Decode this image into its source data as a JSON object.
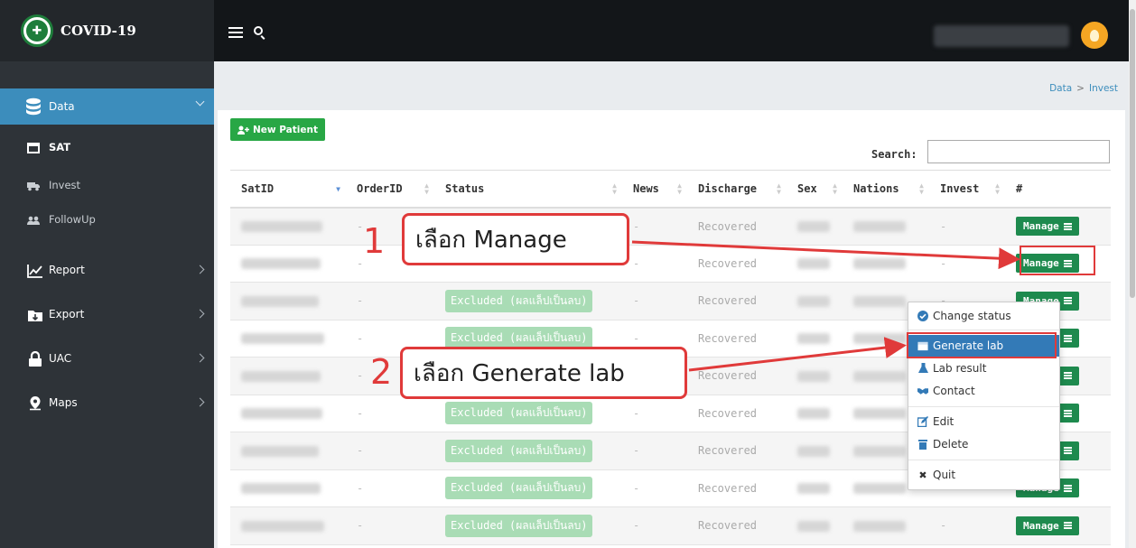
{
  "app": {
    "title": "COVID-19"
  },
  "sidebar": {
    "items": [
      {
        "label": "Data",
        "icon": "database-icon"
      },
      {
        "label": "SAT",
        "icon": "window-icon"
      },
      {
        "label": "Invest",
        "icon": "truck-icon"
      },
      {
        "label": "FollowUp",
        "icon": "users-icon"
      },
      {
        "label": "Report",
        "icon": "line-chart-icon"
      },
      {
        "label": "Export",
        "icon": "folder-icon"
      },
      {
        "label": "UAC",
        "icon": "lock-icon"
      },
      {
        "label": "Maps",
        "icon": "map-marker-icon"
      }
    ]
  },
  "breadcrumb": {
    "home": "Data",
    "sep": ">",
    "current": "Invest"
  },
  "toolbar": {
    "new_patient": "New Patient",
    "search_label": "Search:",
    "search_value": ""
  },
  "table": {
    "columns": [
      "SatID",
      "OrderID",
      "Status",
      "News",
      "Discharge",
      "Sex",
      "Nations",
      "Invest",
      "#"
    ],
    "rows": [
      {
        "order": "-",
        "status": "",
        "news": "-",
        "discharge": "Recovered",
        "invest": "-",
        "action": "Manage"
      },
      {
        "order": "-",
        "status": "",
        "news": "-",
        "discharge": "Recovered",
        "invest": "-",
        "action": "Manage"
      },
      {
        "order": "-",
        "status": "Excluded (ผลแล็ปเป็นลบ)",
        "news": "-",
        "discharge": "Recovered",
        "invest": "-",
        "action": "Manage"
      },
      {
        "order": "-",
        "status": "Excluded (ผลแล็ปเป็นลบ)",
        "news": "-",
        "discharge": "Recovered",
        "invest": "-",
        "action": "Manage"
      },
      {
        "order": "-",
        "status": "",
        "news": "-",
        "discharge": "Recovered",
        "invest": "",
        "action": "Manage"
      },
      {
        "order": "-",
        "status": "Excluded (ผลแล็ปเป็นลบ)",
        "news": "-",
        "discharge": "Recovered",
        "invest": "",
        "action": "Manage"
      },
      {
        "order": "-",
        "status": "Excluded (ผลแล็ปเป็นลบ)",
        "news": "-",
        "discharge": "Recovered",
        "invest": "",
        "action": "Manage"
      },
      {
        "order": "-",
        "status": "Excluded (ผลแล็ปเป็นลบ)",
        "news": "-",
        "discharge": "Recovered",
        "invest": "",
        "action": "Manage"
      },
      {
        "order": "-",
        "status": "Excluded (ผลแล็ปเป็นลบ)",
        "news": "-",
        "discharge": "Recovered",
        "invest": "-",
        "action": "Manage"
      }
    ]
  },
  "dropdown": {
    "items": [
      {
        "label": "Change status",
        "icon": "check-circle-icon"
      },
      {
        "label": "Generate lab",
        "icon": "window-icon"
      },
      {
        "label": "Lab result",
        "icon": "flask-icon"
      },
      {
        "label": "Contact",
        "icon": "handshake-icon"
      },
      {
        "label": "Edit",
        "icon": "edit-icon"
      },
      {
        "label": "Delete",
        "icon": "trash-icon"
      },
      {
        "label": "Quit",
        "icon": "close-icon"
      }
    ]
  },
  "annotations": {
    "step1_num": "1",
    "step1_text": "เลือก Manage",
    "step2_num": "2",
    "step2_text": "เลือก Generate lab"
  },
  "colors": {
    "sidebar": "#2e3338",
    "topbar": "#131619",
    "active": "#3c8dbc",
    "success": "#1e8a4e",
    "annotation": "#e03a3a"
  }
}
